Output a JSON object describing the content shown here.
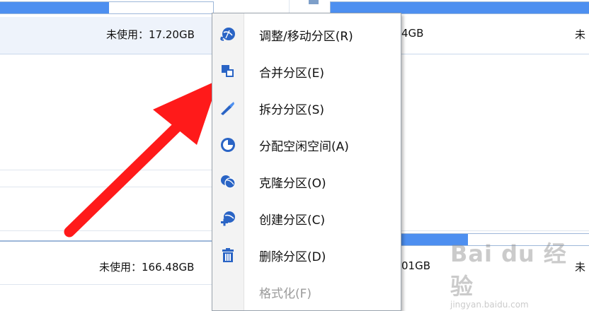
{
  "partitions": {
    "top_left_unused": "未使用：17.20GB",
    "top_right_size_fragment": "4GB",
    "top_far_right": "未",
    "bottom_left_unused": "未使用：166.48GB",
    "bottom_right_size_fragment": "01GB",
    "bottom_far_right": "未",
    "bar_fill_top_left": 0.5,
    "bar_fill_top_right": 1.0,
    "bar_fill_bottom_right": 0.3
  },
  "context_menu": {
    "items": [
      {
        "label": "调整/移动分区(R)",
        "icon": "resize-move-icon",
        "enabled": true
      },
      {
        "label": "合并分区(E)",
        "icon": "merge-icon",
        "enabled": true
      },
      {
        "label": "拆分分区(S)",
        "icon": "split-icon",
        "enabled": true
      },
      {
        "label": "分配空闲空间(A)",
        "icon": "allocate-space-icon",
        "enabled": true
      },
      {
        "label": "克隆分区(O)",
        "icon": "clone-icon",
        "enabled": true
      },
      {
        "label": "创建分区(C)",
        "icon": "create-partition-icon",
        "enabled": true
      },
      {
        "label": "删除分区(D)",
        "icon": "delete-icon",
        "enabled": true
      },
      {
        "label": "格式化(F)",
        "icon": "format-icon",
        "enabled": false
      }
    ]
  },
  "watermark": {
    "brand": "Bai du 经验",
    "url": "jingyan.baidu.com"
  },
  "colors": {
    "accent": "#4d8ff0",
    "icon_blue": "#2a64c5",
    "arrow": "#ff1a1a"
  }
}
